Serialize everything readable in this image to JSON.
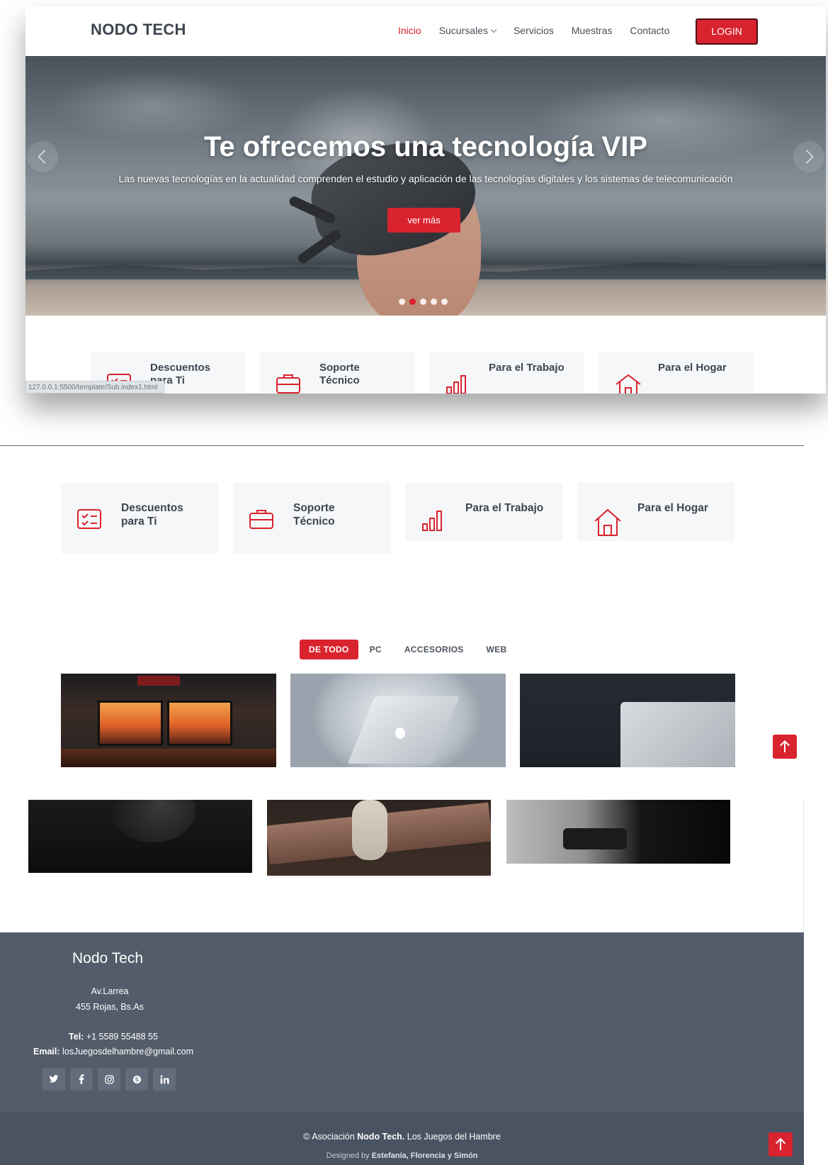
{
  "header": {
    "brand": "NODO TECH",
    "nav": [
      "Inicio",
      "Sucursales",
      "Servicios",
      "Muestras",
      "Contacto"
    ],
    "login": "LOGIN"
  },
  "hero": {
    "title": "Te ofrecemos una tecnología VIP",
    "subtitle": "Las nuevas tecnologías en la actualidad comprenden el estudio y aplicación de las tecnologías digitales y los sistemas de telecomunicación",
    "button": "ver más",
    "slides": 5,
    "active_slide": 2
  },
  "status_url": "127.0.0.1:5500/template/Sub.index1.html",
  "features": [
    {
      "label": "Descuentos para Ti",
      "icon": "checklist-icon"
    },
    {
      "label": "Soporte Técnico",
      "icon": "briefcase-icon"
    },
    {
      "label": "Para el Trabajo",
      "icon": "bar-chart-icon"
    },
    {
      "label": "Para el Hogar",
      "icon": "house-icon"
    }
  ],
  "filters": [
    "DE TODO",
    "PC",
    "ACCESORIOS",
    "WEB"
  ],
  "footer": {
    "title": "Nodo Tech",
    "address_1": "Av.Larrea",
    "address_2": "455 Rojas, Bs.As",
    "tel_label": "Tel:",
    "tel": "+1 5589 55488 55",
    "email_label": "Email:",
    "email": "losJuegosdelhambre@gmail.com",
    "socials": [
      "twitter-icon",
      "facebook-icon",
      "instagram-icon",
      "skype-icon",
      "linkedin-icon"
    ],
    "copyright_prefix": "© Asociación",
    "copyright_brand": "Nodo Tech.",
    "copyright_suffix": "Los Juegos del Hambre",
    "designed_prefix": "Designed by",
    "designed_by": "Estefanía, Florencia y Simón"
  },
  "colors": {
    "accent": "#d9232e",
    "footer_bg": "#535c6a",
    "text_dark": "#3d4550"
  }
}
